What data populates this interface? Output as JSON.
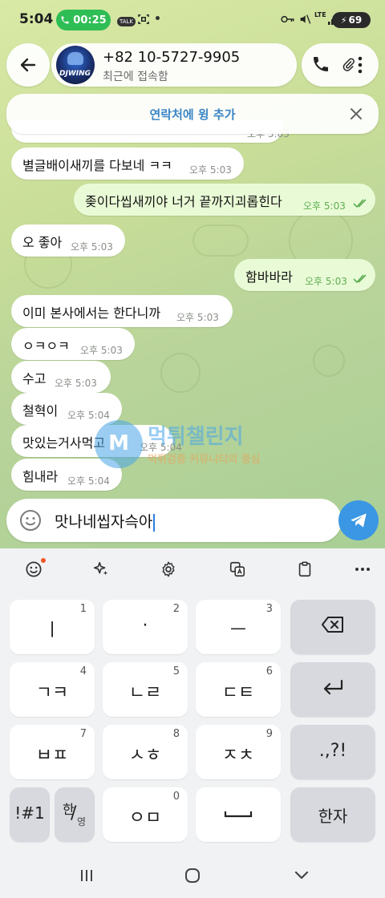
{
  "status_bar": {
    "time": "5:04",
    "call_timer": "00:25",
    "talk_label": "TALK",
    "network": "LTE",
    "battery": "69"
  },
  "header": {
    "contact_number": "+82 10-5727-9905",
    "contact_status": "최근에 접속함",
    "avatar_text": "DJWING"
  },
  "banner": {
    "add_contact_label": "연락처에 윙 추가"
  },
  "messages": [
    {
      "text": "별글배이새끼를 다보네 ㅋㅋ",
      "time": "오후 5:03",
      "dir": "in"
    },
    {
      "text": "좆이다씹새끼야 너거 끝까지괴롭힌다",
      "time": "오후 5:03",
      "dir": "out"
    },
    {
      "text": "오 좋아",
      "time": "오후 5:03",
      "dir": "in"
    },
    {
      "text": "함바바라",
      "time": "오후 5:03",
      "dir": "out"
    },
    {
      "text": "이미 본사에서는 한다니까",
      "time": "오후 5:03",
      "dir": "in"
    },
    {
      "text": "ㅇㅋㅇㅋ",
      "time": "오후 5:03",
      "dir": "in"
    },
    {
      "text": "수고",
      "time": "오후 5:03",
      "dir": "in"
    },
    {
      "text": "철혁이",
      "time": "오후 5:04",
      "dir": "in"
    },
    {
      "text": "맛있는거사먹고",
      "time": "오후 5:04",
      "dir": "in"
    },
    {
      "text": "힘내라",
      "time": "오후 5:04",
      "dir": "in"
    }
  ],
  "partial_top_message": {
    "time": "오후 5:03"
  },
  "watermark": {
    "title": "먹튀챌린지",
    "subtitle": "먹튀검증 커뮤니티의 중심",
    "logo": "M"
  },
  "composer": {
    "text": "맛나네씹자슥아"
  },
  "keyboard": {
    "rows": [
      [
        {
          "label": "ㅣ",
          "num": "1"
        },
        {
          "label": "·",
          "num": "2"
        },
        {
          "label": "ㅡ",
          "num": "3"
        }
      ],
      [
        {
          "label": "ㄱㅋ",
          "num": "4"
        },
        {
          "label": "ㄴㄹ",
          "num": "5"
        },
        {
          "label": "ㄷㅌ",
          "num": "6"
        }
      ],
      [
        {
          "label": "ㅂㅍ",
          "num": "7"
        },
        {
          "label": "ㅅㅎ",
          "num": "8"
        },
        {
          "label": "ㅈㅊ",
          "num": "9"
        }
      ]
    ],
    "punct_label": ".,?!",
    "symbols_label": "!#1",
    "lang_top": "한",
    "lang_bottom": "영",
    "zero_key": {
      "label": "ㅇㅁ",
      "num": "0"
    },
    "hanja_label": "한자"
  }
}
